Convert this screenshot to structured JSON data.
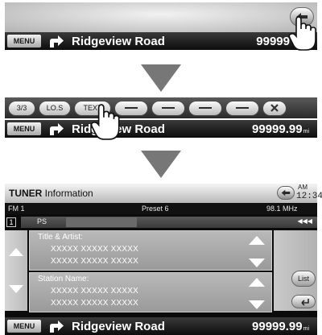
{
  "nav": {
    "menu_label": "MENU",
    "road_name": "Ridgeview Road",
    "distance_value": "99999.99",
    "distance_unit": "mi",
    "panel1_distance_value": "99999"
  },
  "toolbar": {
    "buttons": [
      "3/3",
      "LO.S",
      "TEXT"
    ]
  },
  "tuner": {
    "title_bold": "TUNER",
    "title_rest": " Information",
    "clock_ampm": "AM",
    "clock_time": "12:34",
    "band": "FM 1",
    "preset": "Preset 6",
    "frequency": "98.1 MHz",
    "preset_number": "1",
    "ps_label": "PS",
    "title_artist_label": "Title & Artist:",
    "title_artist_lines": [
      "XXXXX XXXXX XXXXX",
      "XXXXX XXXXX XXXXX"
    ],
    "station_name_label": "Station Name:",
    "station_name_lines": [
      "XXXXX XXXXX XXXXX",
      "XXXXX XXXXX XXXXX"
    ],
    "list_label": "List"
  },
  "icons": [
    "back-arrow-icon",
    "turn-right-arrow-icon",
    "hand-pointer-icon",
    "close-icon",
    "scroll-up-icon",
    "scroll-down-icon",
    "return-icon",
    "rewind-icon"
  ],
  "colors": {
    "bar_dark": "#1a1a1a",
    "arrow_gray": "#777777",
    "panel_gray": "#b0b0b0"
  }
}
